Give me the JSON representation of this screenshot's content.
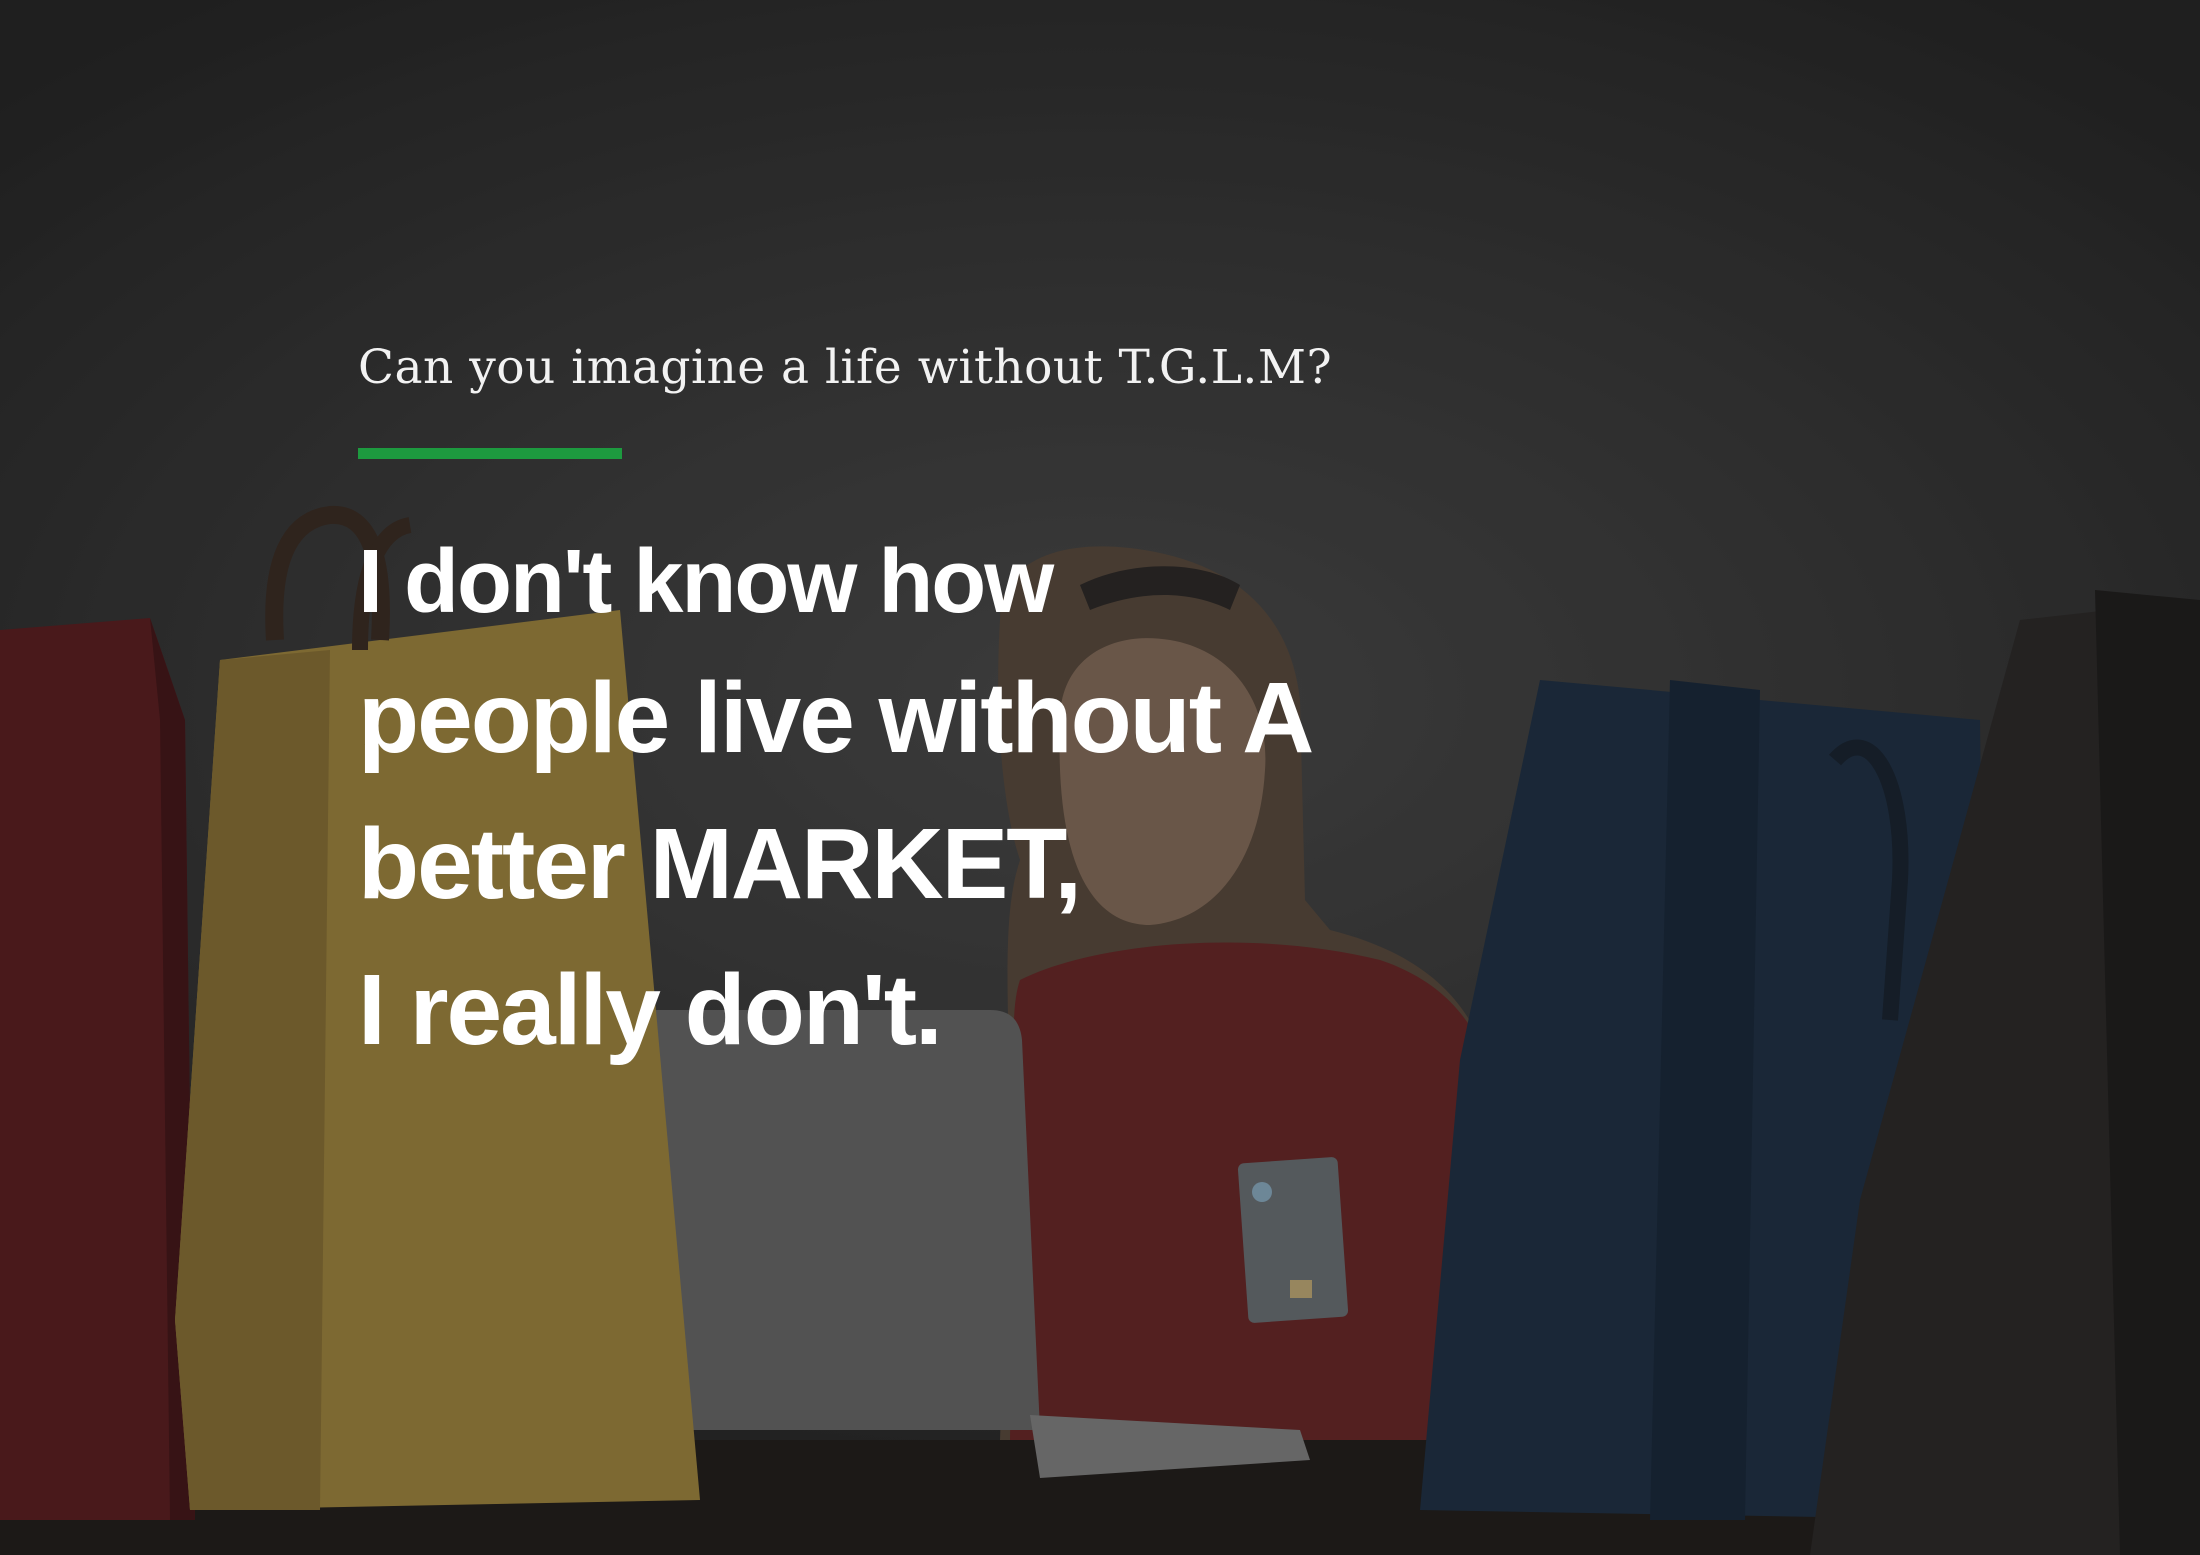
{
  "poster": {
    "kicker": "Can you imagine a life without T.G.L.M?",
    "headline": {
      "line1": "I don't know how",
      "line2": "people live without A",
      "line3": "better MARKET,",
      "line4": "I really don't."
    }
  },
  "colors": {
    "accent": "#1d9a3f",
    "text": "#ffffff",
    "background": "#2d2d2d"
  }
}
